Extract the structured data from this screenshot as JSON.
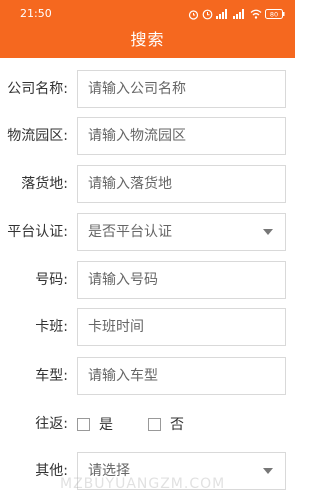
{
  "status_bar": {
    "time": "21:50",
    "icons": [
      "alarm-icon",
      "clock-icon",
      "signal-icon",
      "signal-icon",
      "wifi-icon",
      "battery-icon"
    ],
    "battery": "80"
  },
  "header": {
    "title": "搜索",
    "color": "#f5681f"
  },
  "form": {
    "company": {
      "label": "公司名称:",
      "placeholder": "请输入公司名称"
    },
    "logistics_park": {
      "label": "物流园区:",
      "placeholder": "请输入物流园区"
    },
    "destination": {
      "label": "落货地:",
      "placeholder": "请输入落货地"
    },
    "platform_cert": {
      "label": "平台认证:",
      "selected": "是否平台认证"
    },
    "number": {
      "label": "号码:",
      "placeholder": "请输入号码"
    },
    "shift": {
      "label": "卡班:",
      "placeholder": "卡班时间"
    },
    "vehicle_type": {
      "label": "车型:",
      "placeholder": "请输入车型"
    },
    "round_trip": {
      "label": "往返:",
      "options": [
        "是",
        "否"
      ]
    },
    "other": {
      "label": "其他:",
      "selected": "请选择"
    }
  },
  "watermark": "MZBUYUANGZM.COM"
}
